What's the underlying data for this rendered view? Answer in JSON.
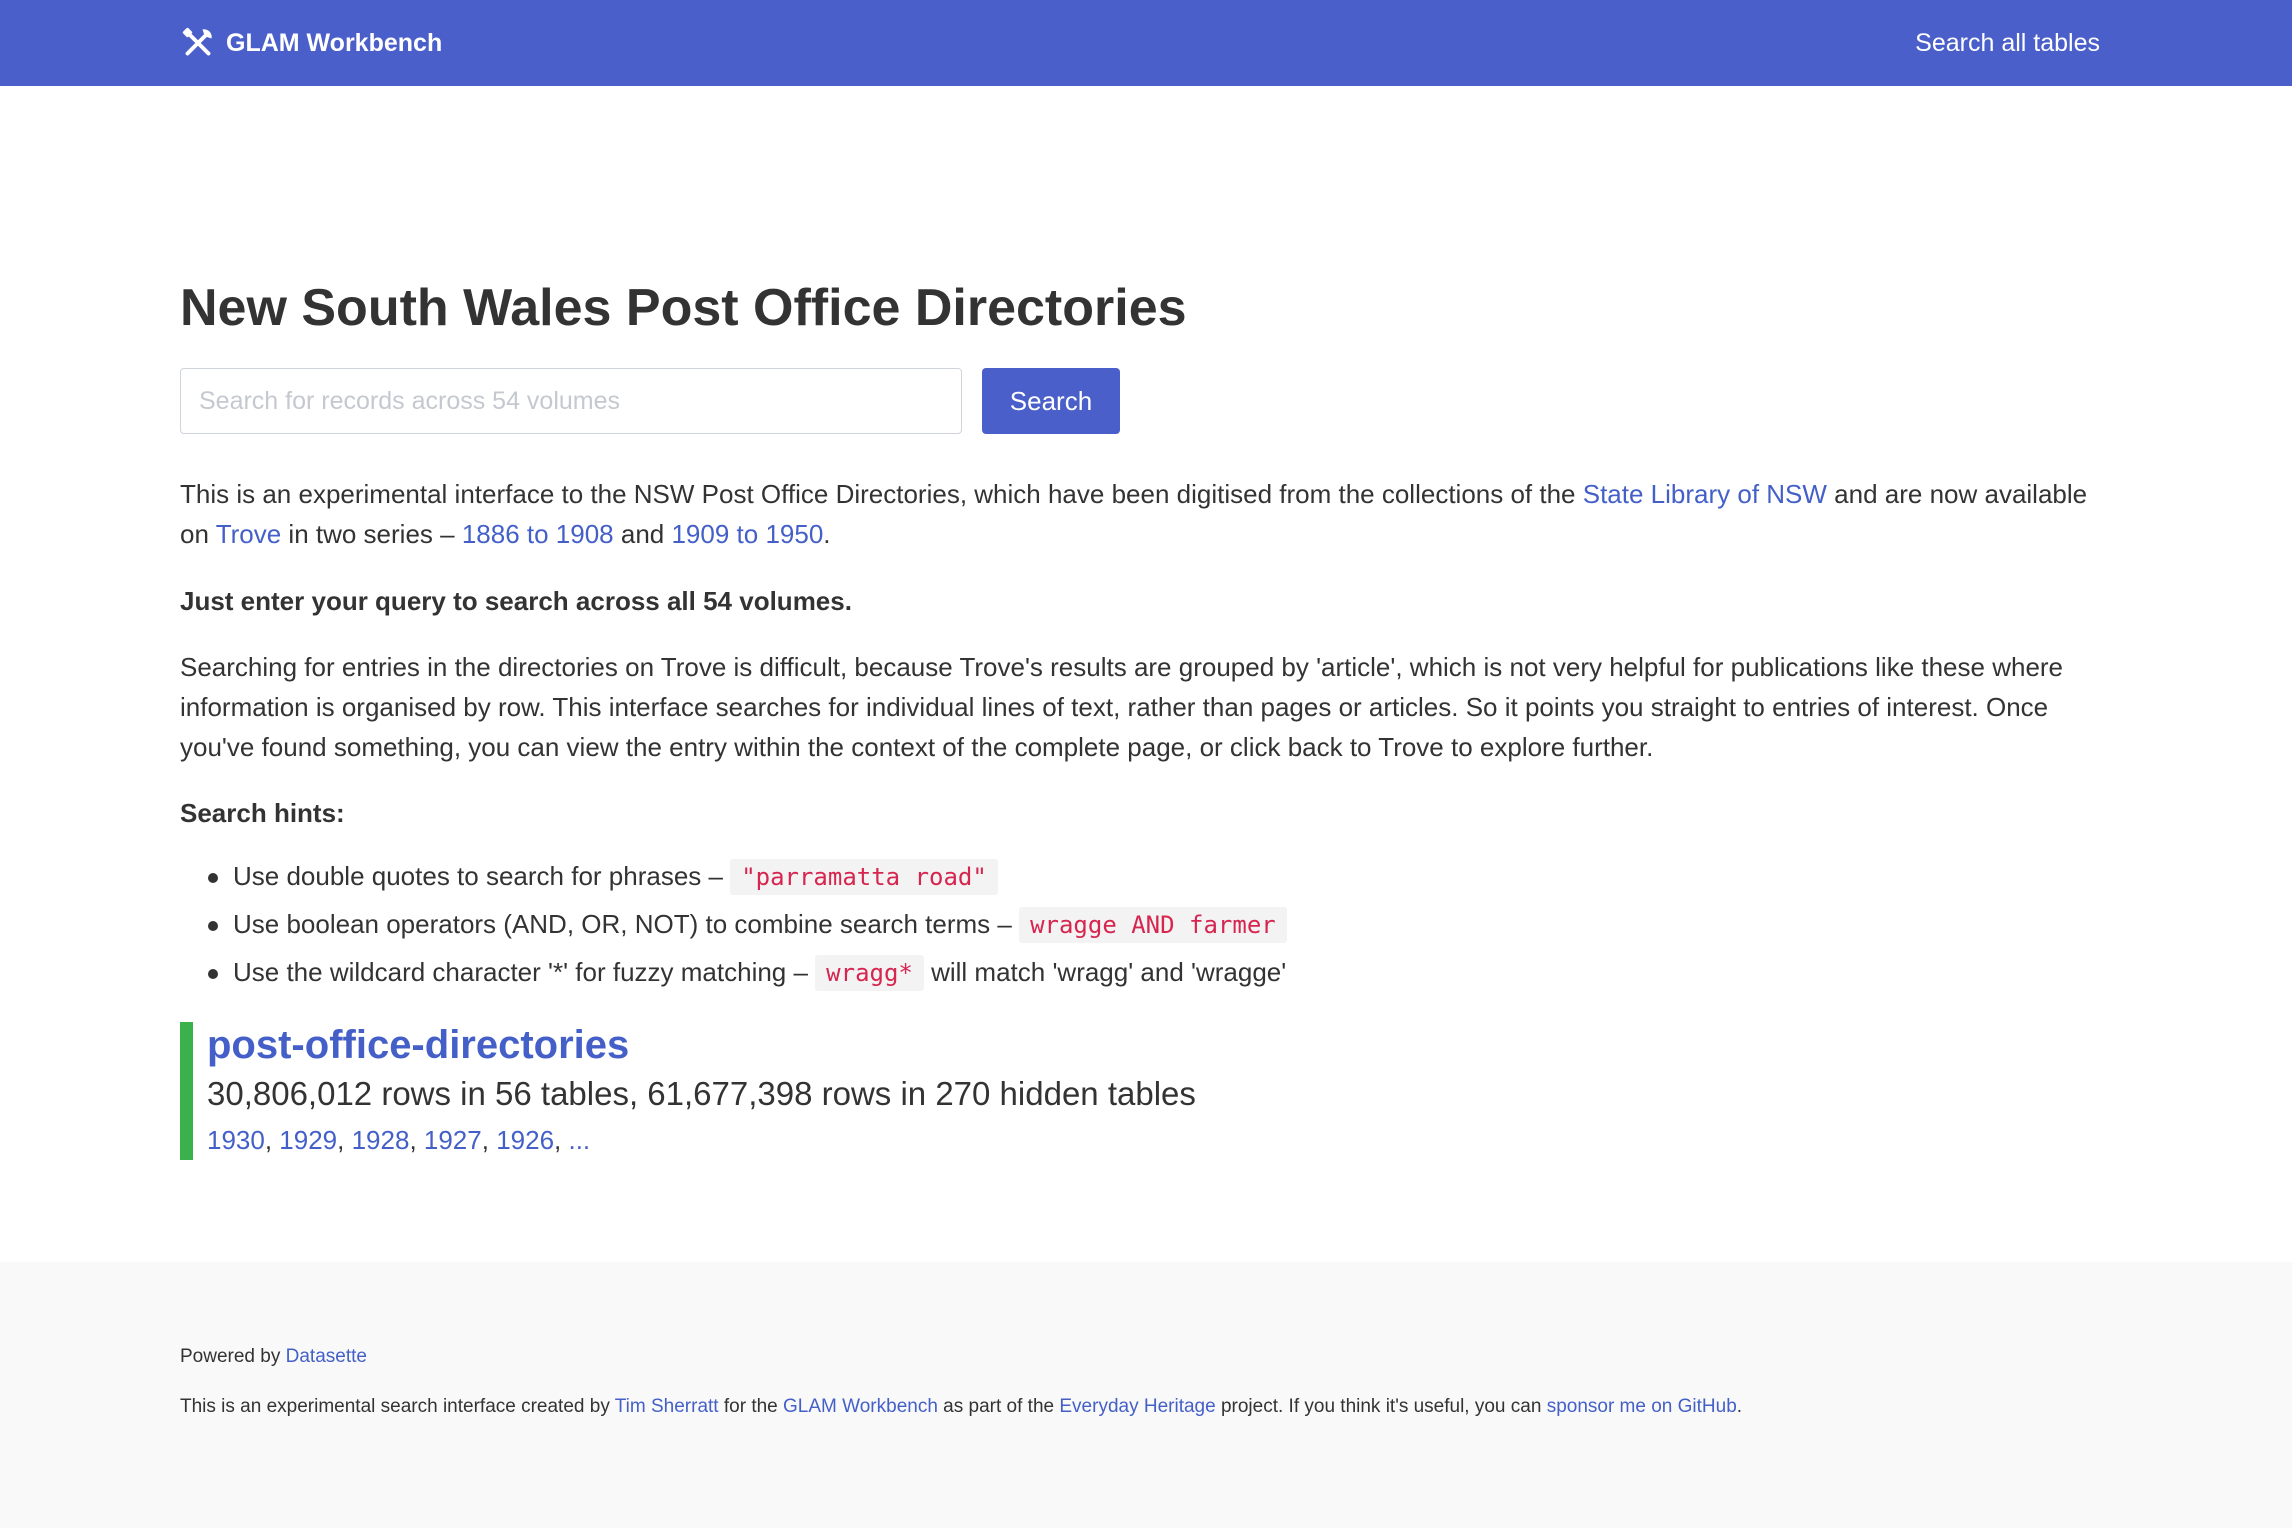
{
  "header": {
    "brand": "GLAM Workbench",
    "brand_icon": "tools-icon",
    "nav_link": "Search all tables"
  },
  "page": {
    "title": "New South Wales Post Office Directories"
  },
  "search": {
    "placeholder": "Search for records across 54 volumes",
    "value": "",
    "button_label": "Search"
  },
  "intro": {
    "text1": "This is an experimental interface to the NSW Post Office Directories, which have been digitised from the collections of the ",
    "link_state_library": "State Library of NSW",
    "text2": " and are now available on ",
    "link_trove": "Trove",
    "text3": " in two series – ",
    "link_series1": "1886 to 1908",
    "text4": " and ",
    "link_series2": "1909 to 1950",
    "text5": "."
  },
  "query_note": "Just enter your query to search across all 54 volumes.",
  "explanation": "Searching for entries in the directories on Trove is difficult, because Trove's results are grouped by 'article', which is not very helpful for publications like these where information is organised by row. This interface searches for individual lines of text, rather than pages or articles. So it points you straight to entries of interest. Once you've found something, you can view the entry within the context of the complete page, or click back to Trove to explore further.",
  "hints": {
    "label": "Search hints:",
    "items": [
      {
        "text": "Use double quotes to search for phrases – ",
        "code": "\"parramatta road\"",
        "after": ""
      },
      {
        "text": "Use boolean operators (AND, OR, NOT) to combine search terms – ",
        "code": "wragge AND farmer",
        "after": ""
      },
      {
        "text": "Use the wildcard character '*' for fuzzy matching – ",
        "code": "wragg*",
        "after": " will match 'wragg' and 'wragge'"
      }
    ]
  },
  "database": {
    "name": "post-office-directories",
    "counts": "30,806,012 rows in 56 tables, 61,677,398 rows in 270 hidden tables",
    "tables": [
      "1930",
      "1929",
      "1928",
      "1927",
      "1926"
    ],
    "more": "...",
    "separator": ", ",
    "accent_color": "#3ab14a"
  },
  "footer": {
    "powered_text": "Powered by ",
    "powered_link": "Datasette",
    "credits": {
      "t1": "This is an experimental search interface created by ",
      "l1": "Tim Sherratt",
      "t2": " for the ",
      "l2": "GLAM Workbench",
      "t3": " as part of the ",
      "l3": "Everyday Heritage",
      "t4": " project. If you think it's useful, you can ",
      "l4": "sponsor me on GitHub",
      "t5": "."
    }
  },
  "colors": {
    "navbar": "#4a5fc9",
    "link": "#4460c8",
    "code": "#d6264f"
  }
}
